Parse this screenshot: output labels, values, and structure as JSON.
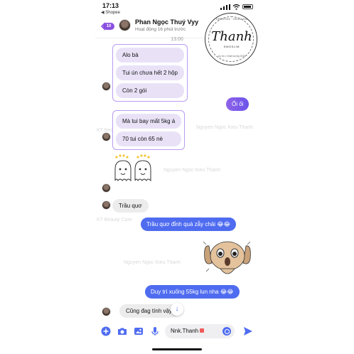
{
  "status_bar": {
    "time": "17:13",
    "back_app": "◀ Shopee"
  },
  "header": {
    "unread_count": "10",
    "contact_name": "Phan Ngọc Thuý Vyy",
    "presence": "Hoạt động 16 phút trước"
  },
  "logo": {
    "top_text": "DMSSHI56 · 098437466",
    "script": "Thanh",
    "sub": "EMOSLIM",
    "bottom_text": "Uy tín • Chất lượng 2022"
  },
  "timestamp": "13:00",
  "messages": {
    "group1": [
      "Alo bà",
      "Tui ún chưa hết 2 hộp",
      "Còn 2 gói"
    ],
    "out1": "Ối ối",
    "group2": [
      "Mà tui bay mất 5kg á",
      "70 tui còn 65 nè"
    ],
    "in_trau": "Trầu quơ",
    "out2": "Trầu quơ đỉnh quá zẫy chải 😂😂",
    "out3": "Duy trì xuống 55kg lun nha 😂😂",
    "in_last": "Cũng đag tính vậy"
  },
  "watermarks": {
    "w1": "KT Beauty Care",
    "w2": "Nguyen Ngoc Kieu Thanh",
    "w3": "Nguyen Ngoc Kieu Thanh",
    "w4": "KT Beauty Care",
    "w5": "Nguyen Ngoc Kieu Thanh"
  },
  "composer": {
    "input_value": "Nnk.Thanh"
  },
  "colors": {
    "accent": "#8a4fe0",
    "outgoing": "#4f6cf0",
    "incoming": "#e9e2f7"
  }
}
